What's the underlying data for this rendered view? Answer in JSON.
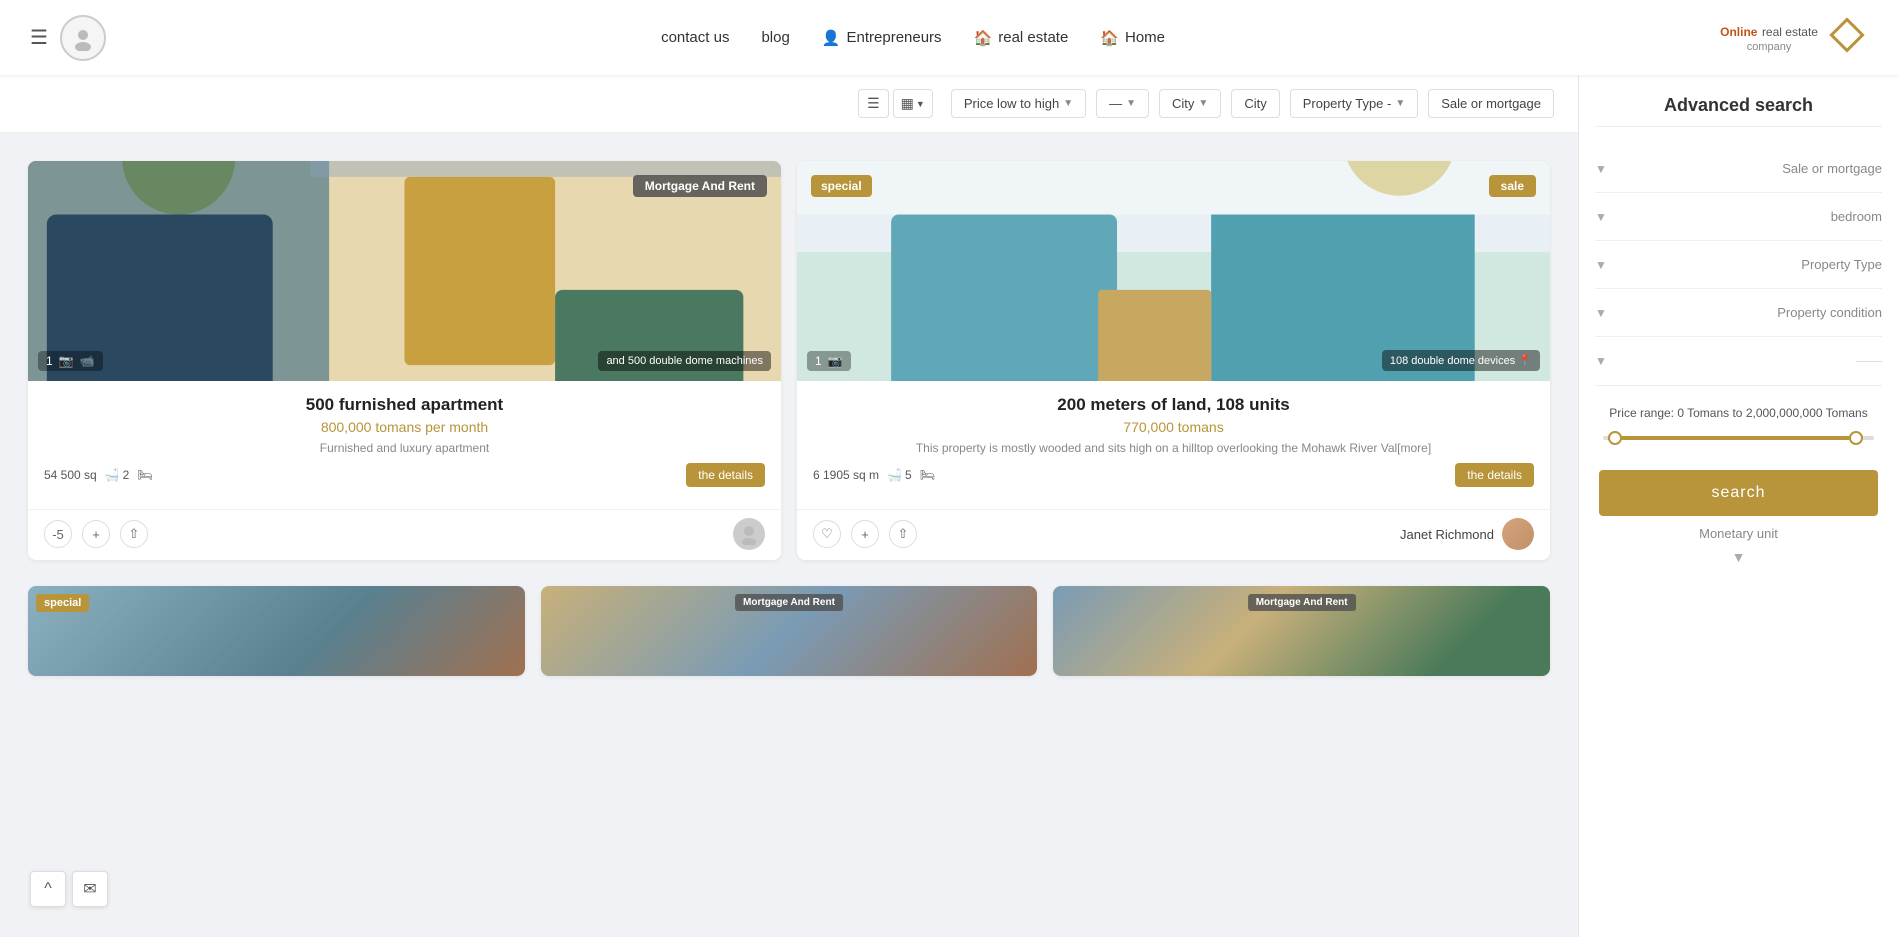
{
  "header": {
    "nav_items": [
      {
        "label": "Home",
        "icon": "🏠"
      },
      {
        "label": "real estate",
        "icon": "🏠"
      },
      {
        "label": "Entrepreneurs",
        "icon": "👤"
      },
      {
        "label": "blog",
        "icon": ""
      },
      {
        "label": "contact us",
        "icon": ""
      }
    ],
    "logo": {
      "brand": "company",
      "online": "Online",
      "tagline": "real estate"
    }
  },
  "sidebar": {
    "title": "Advanced search",
    "sections": [
      {
        "label": "Sale or mortgage",
        "id": "sale-or-mortgage"
      },
      {
        "label": "bedroom",
        "id": "bedroom"
      },
      {
        "label": "Property Type",
        "id": "property-type-adv"
      },
      {
        "label": "Property condition",
        "id": "property-condition"
      },
      {
        "label": "",
        "id": "extra"
      }
    ],
    "price_range": {
      "label": "Price range: 0 Tomans to 2,000,000,000 Tomans"
    },
    "search_btn": "search",
    "monetary_unit": "Monetary unit"
  },
  "filter_bar": {
    "sort_label": "Price low to high",
    "separator": "—",
    "city1_label": "City",
    "city2_label": "City",
    "property_type_label": "Property Type -",
    "sale_mortgage_label": "Sale or mortgage"
  },
  "properties": [
    {
      "id": 1,
      "title": "500 furnished apartment",
      "price": "800,000 tomans per month",
      "description": "Furnished and luxury apartment",
      "badge": "Mortgage And Rent",
      "badge_type": "mortgage",
      "photo_count": "1",
      "overlay_text": "and 500 double dome machines",
      "area": "54 500 sq",
      "bathrooms": "2",
      "bedrooms": "",
      "details_btn": "the details",
      "has_agent": false,
      "like_count": "-5"
    },
    {
      "id": 2,
      "title": "200 meters of land, 108 units",
      "price": "770,000 tomans",
      "description": "This property is mostly wooded and sits high on a hilltop overlooking the Mohawk River Val[more]",
      "badge": "sale",
      "badge_type": "sale",
      "photo_count": "1",
      "overlay_text": "108 double dome devices",
      "area": "6 1905 sq m",
      "bathrooms": "5",
      "bedrooms": "",
      "details_btn": "the details",
      "has_agent": true,
      "agent_name": "Janet Richmond",
      "like_count": ""
    }
  ],
  "bottom_cards": [
    {
      "id": 3,
      "badge": "special",
      "badge_type": "special",
      "img_class": "img-bottom1"
    },
    {
      "id": 4,
      "badge": "Mortgage And Rent",
      "badge_type": "mortgage",
      "img_class": "img-bottom2"
    },
    {
      "id": 5,
      "badge": "Mortgage And Rent",
      "badge_type": "mortgage",
      "img_class": "img-bottom3"
    }
  ],
  "float": {
    "up_label": "^",
    "mail_label": "✉"
  }
}
